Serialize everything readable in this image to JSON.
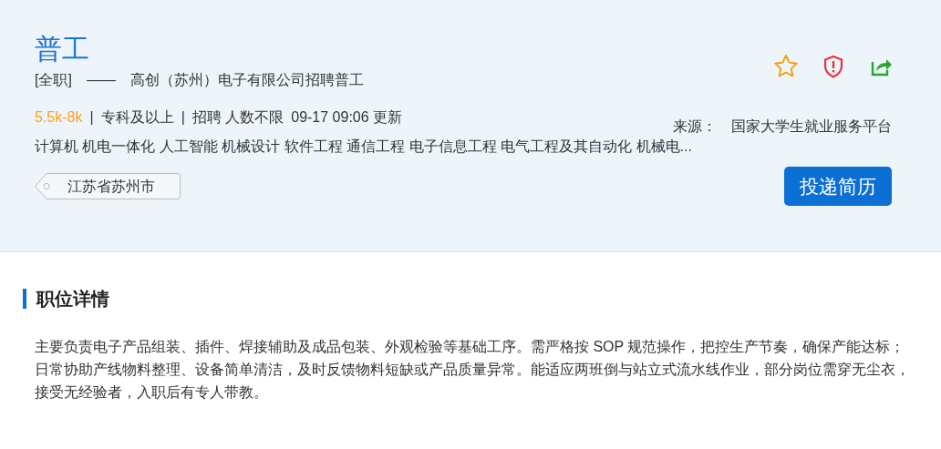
{
  "job": {
    "title": "普工",
    "employment_type": "[全职]",
    "dash": "——",
    "company_line": "高创（苏州）电子有限公司招聘普工",
    "salary": "5.5k-8k",
    "separators": [
      "|",
      "|"
    ],
    "education": "专科及以上",
    "headcount": "招聘 人数不限",
    "updated": "09-17 09:06 更新",
    "majors": "计算机 机电一体化 人工智能 机械设计 软件工程 通信工程 电子信息工程 电气工程及其自动化 机械电...",
    "location": "江苏省苏州市",
    "source_label": "来源：",
    "source": "国家大学生就业服务平台",
    "apply_button": "投递简历"
  },
  "details": {
    "heading": "职位详情",
    "text": "主要负责电子产品组装、插件、焊接辅助及成品包装、外观检验等基础工序。需严格按 SOP 规范操作，把控生产节奏，确保产能达标；日常协助产线物料整理、设备简单清洁，及时反馈物料短缺或产品质量异常。能适应两班倒与站立式流水线作业，部分岗位需穿无尘衣，接受无经验者，入职后有专人带教。"
  }
}
